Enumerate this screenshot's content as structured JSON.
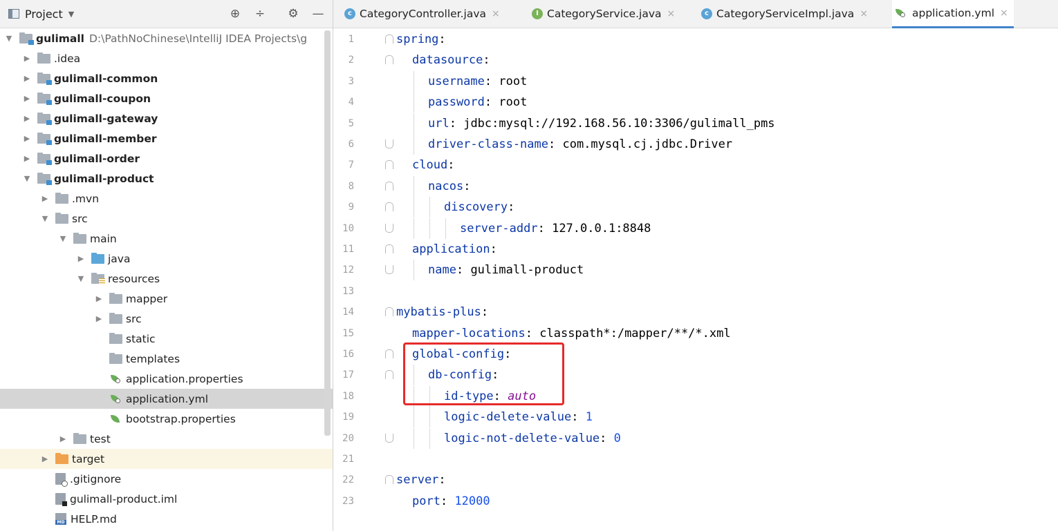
{
  "project_panel": {
    "title": "Project",
    "tree": [
      {
        "label": "gulimall",
        "path": "D:\\PathNoChinese\\IntelliJ IDEA Projects\\g",
        "bold": true,
        "indent": 0,
        "arrow": "open",
        "icon": "module-folder"
      },
      {
        "label": ".idea",
        "bold": false,
        "indent": 1,
        "arrow": "closed",
        "icon": "folder"
      },
      {
        "label": "gulimall-common",
        "bold": true,
        "indent": 1,
        "arrow": "closed",
        "icon": "module-folder"
      },
      {
        "label": "gulimall-coupon",
        "bold": true,
        "indent": 1,
        "arrow": "closed",
        "icon": "module-folder"
      },
      {
        "label": "gulimall-gateway",
        "bold": true,
        "indent": 1,
        "arrow": "closed",
        "icon": "module-folder"
      },
      {
        "label": "gulimall-member",
        "bold": true,
        "indent": 1,
        "arrow": "closed",
        "icon": "module-folder"
      },
      {
        "label": "gulimall-order",
        "bold": true,
        "indent": 1,
        "arrow": "closed",
        "icon": "module-folder"
      },
      {
        "label": "gulimall-product",
        "bold": true,
        "indent": 1,
        "arrow": "open",
        "icon": "module-folder"
      },
      {
        "label": ".mvn",
        "bold": false,
        "indent": 2,
        "arrow": "closed",
        "icon": "folder"
      },
      {
        "label": "src",
        "bold": false,
        "indent": 2,
        "arrow": "open",
        "icon": "folder"
      },
      {
        "label": "main",
        "bold": false,
        "indent": 3,
        "arrow": "open",
        "icon": "folder"
      },
      {
        "label": "java",
        "bold": false,
        "indent": 4,
        "arrow": "closed",
        "icon": "source-folder"
      },
      {
        "label": "resources",
        "bold": false,
        "indent": 4,
        "arrow": "open",
        "icon": "resources-folder"
      },
      {
        "label": "mapper",
        "bold": false,
        "indent": 5,
        "arrow": "closed",
        "icon": "folder"
      },
      {
        "label": "src",
        "bold": false,
        "indent": 5,
        "arrow": "closed",
        "icon": "folder"
      },
      {
        "label": "static",
        "bold": false,
        "indent": 5,
        "arrow": "none",
        "icon": "folder"
      },
      {
        "label": "templates",
        "bold": false,
        "indent": 5,
        "arrow": "none",
        "icon": "folder"
      },
      {
        "label": "application.properties",
        "bold": false,
        "indent": 5,
        "arrow": "none",
        "icon": "spring-config"
      },
      {
        "label": "application.yml",
        "bold": false,
        "indent": 5,
        "arrow": "none",
        "icon": "spring-config",
        "selected": true
      },
      {
        "label": "bootstrap.properties",
        "bold": false,
        "indent": 5,
        "arrow": "none",
        "icon": "spring-leaf"
      },
      {
        "label": "test",
        "bold": false,
        "indent": 3,
        "arrow": "closed",
        "icon": "folder"
      },
      {
        "label": "target",
        "bold": false,
        "indent": 2,
        "arrow": "closed",
        "icon": "target-folder",
        "excluded": true
      },
      {
        "label": ".gitignore",
        "bold": false,
        "indent": 2,
        "arrow": "none",
        "icon": "gitignore-file"
      },
      {
        "label": "gulimall-product.iml",
        "bold": false,
        "indent": 2,
        "arrow": "none",
        "icon": "iml-file"
      },
      {
        "label": "HELP.md",
        "bold": false,
        "indent": 2,
        "arrow": "none",
        "icon": "markdown-file"
      }
    ]
  },
  "tabs": [
    {
      "label": "CategoryController.java",
      "icon": "class",
      "icon_char": "c",
      "active": false
    },
    {
      "label": "CategoryService.java",
      "icon": "iface",
      "icon_char": "I",
      "active": false
    },
    {
      "label": "CategoryServiceImpl.java",
      "icon": "class",
      "icon_char": "c",
      "active": false
    },
    {
      "label": "application.yml",
      "icon": "yml",
      "icon_char": "",
      "active": true
    }
  ],
  "tab_close_glyph": "×",
  "editor": {
    "lines": [
      {
        "n": "1",
        "indent": 0,
        "key": "spring",
        "sep": ":",
        "value": "",
        "vtype": "",
        "fold": "open"
      },
      {
        "n": "2",
        "indent": 1,
        "key": "datasource",
        "sep": ":",
        "value": "",
        "vtype": "",
        "fold": "open"
      },
      {
        "n": "3",
        "indent": 2,
        "key": "username",
        "sep": ": ",
        "value": "root",
        "vtype": "plain",
        "fold": ""
      },
      {
        "n": "4",
        "indent": 2,
        "key": "password",
        "sep": ": ",
        "value": "root",
        "vtype": "plain",
        "fold": ""
      },
      {
        "n": "5",
        "indent": 2,
        "key": "url",
        "sep": ": ",
        "value": "jdbc:mysql://192.168.56.10:3306/gulimall_pms",
        "vtype": "plain",
        "fold": ""
      },
      {
        "n": "6",
        "indent": 2,
        "key": "driver-class-name",
        "sep": ": ",
        "value": "com.mysql.cj.jdbc.Driver",
        "vtype": "plain",
        "fold": "close"
      },
      {
        "n": "7",
        "indent": 1,
        "key": "cloud",
        "sep": ":",
        "value": "",
        "vtype": "",
        "fold": "open"
      },
      {
        "n": "8",
        "indent": 2,
        "key": "nacos",
        "sep": ":",
        "value": "",
        "vtype": "",
        "fold": "open"
      },
      {
        "n": "9",
        "indent": 3,
        "key": "discovery",
        "sep": ":",
        "value": "",
        "vtype": "",
        "fold": "open"
      },
      {
        "n": "10",
        "indent": 4,
        "key": "server-addr",
        "sep": ": ",
        "value": "127.0.0.1:8848",
        "vtype": "plain",
        "fold": "close"
      },
      {
        "n": "11",
        "indent": 1,
        "key": "application",
        "sep": ":",
        "value": "",
        "vtype": "",
        "fold": "open"
      },
      {
        "n": "12",
        "indent": 2,
        "key": "name",
        "sep": ": ",
        "value": "gulimall-product",
        "vtype": "plain",
        "fold": "close"
      },
      {
        "n": "13",
        "indent": 0,
        "key": "",
        "sep": "",
        "value": "",
        "vtype": "",
        "fold": ""
      },
      {
        "n": "14",
        "indent": 0,
        "key": "mybatis-plus",
        "sep": ":",
        "value": "",
        "vtype": "",
        "fold": "open"
      },
      {
        "n": "15",
        "indent": 1,
        "key": "mapper-locations",
        "sep": ": ",
        "value": "classpath*:/mapper/**/*.xml",
        "vtype": "plain",
        "fold": ""
      },
      {
        "n": "16",
        "indent": 1,
        "key": "global-config",
        "sep": ":",
        "value": "",
        "vtype": "",
        "fold": "open"
      },
      {
        "n": "17",
        "indent": 2,
        "key": "db-config",
        "sep": ":",
        "value": "",
        "vtype": "",
        "fold": "open"
      },
      {
        "n": "18",
        "indent": 3,
        "key": "id-type",
        "sep": ": ",
        "value": "auto",
        "vtype": "italic",
        "fold": ""
      },
      {
        "n": "19",
        "indent": 3,
        "key": "logic-delete-value",
        "sep": ": ",
        "value": "1",
        "vtype": "number",
        "fold": ""
      },
      {
        "n": "20",
        "indent": 3,
        "key": "logic-not-delete-value",
        "sep": ": ",
        "value": "0",
        "vtype": "number",
        "fold": "close"
      },
      {
        "n": "21",
        "indent": 0,
        "key": "",
        "sep": "",
        "value": "",
        "vtype": "",
        "fold": ""
      },
      {
        "n": "22",
        "indent": 0,
        "key": "server",
        "sep": ":",
        "value": "",
        "vtype": "",
        "fold": "open"
      },
      {
        "n": "23",
        "indent": 1,
        "key": "port",
        "sep": ": ",
        "value": "12000",
        "vtype": "number",
        "fold": ""
      }
    ]
  },
  "colors": {
    "yaml_key": "#0b37a6",
    "number": "#1750eb",
    "keyword_value": "#871094",
    "highlight_box": "#e62a2a",
    "active_tab_underline": "#4083c9",
    "selected_row": "#d5d5d5"
  }
}
